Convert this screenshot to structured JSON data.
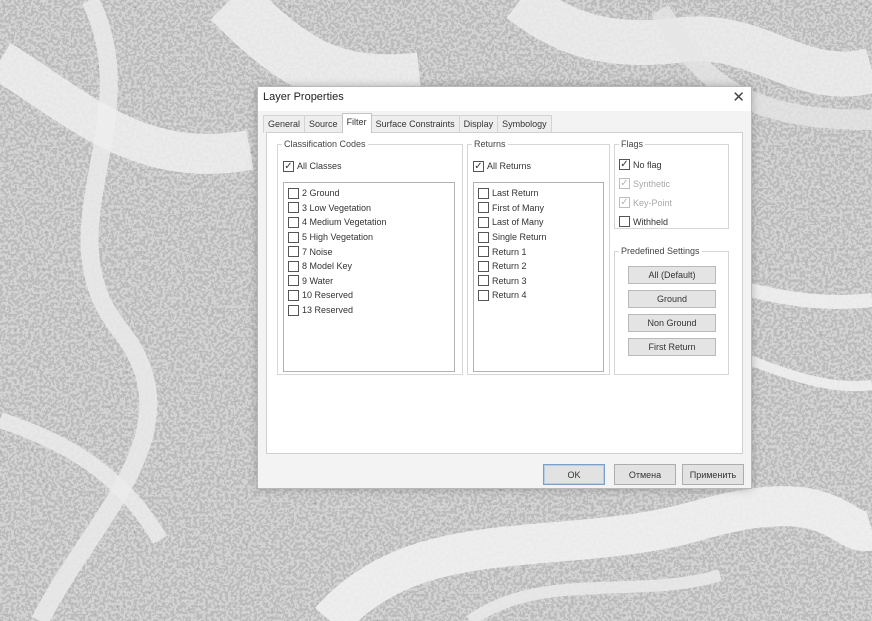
{
  "window": {
    "title": "Layer Properties",
    "close_glyph": "✕"
  },
  "tabs": [
    {
      "label": "General"
    },
    {
      "label": "Source"
    },
    {
      "label": "Filter"
    },
    {
      "label": "Surface Constraints"
    },
    {
      "label": "Display"
    },
    {
      "label": "Symbology"
    }
  ],
  "active_tab": "Filter",
  "classification": {
    "legend": "Classification Codes",
    "all_label": "All Classes",
    "all_checked": true,
    "items": [
      {
        "label": "2 Ground",
        "checked": false
      },
      {
        "label": "3 Low Vegetation",
        "checked": false
      },
      {
        "label": "4 Medium Vegetation",
        "checked": false
      },
      {
        "label": "5 High Vegetation",
        "checked": false
      },
      {
        "label": "7 Noise",
        "checked": false
      },
      {
        "label": "8 Model Key",
        "checked": false
      },
      {
        "label": "9 Water",
        "checked": false
      },
      {
        "label": "10 Reserved",
        "checked": false
      },
      {
        "label": "13 Reserved",
        "checked": false
      }
    ]
  },
  "returns": {
    "legend": "Returns",
    "all_label": "All Returns",
    "all_checked": true,
    "items": [
      {
        "label": "Last Return",
        "checked": false
      },
      {
        "label": "First of Many",
        "checked": false
      },
      {
        "label": "Last of Many",
        "checked": false
      },
      {
        "label": "Single Return",
        "checked": false
      },
      {
        "label": "Return 1",
        "checked": false
      },
      {
        "label": "Return 2",
        "checked": false
      },
      {
        "label": "Return 3",
        "checked": false
      },
      {
        "label": "Return 4",
        "checked": false
      }
    ]
  },
  "flags": {
    "legend": "Flags",
    "items": [
      {
        "label": "No flag",
        "checked": true,
        "disabled": false
      },
      {
        "label": "Synthetic",
        "checked": true,
        "disabled": true
      },
      {
        "label": "Key-Point",
        "checked": true,
        "disabled": true
      },
      {
        "label": "Withheld",
        "checked": false,
        "disabled": false
      }
    ]
  },
  "predefined": {
    "legend": "Predefined Settings",
    "buttons": [
      {
        "label": "All (Default)"
      },
      {
        "label": "Ground"
      },
      {
        "label": "Non Ground"
      },
      {
        "label": "First Return"
      }
    ]
  },
  "footer": {
    "ok_label": "OK",
    "cancel_label": "Отмена",
    "apply_label": "Применить"
  }
}
